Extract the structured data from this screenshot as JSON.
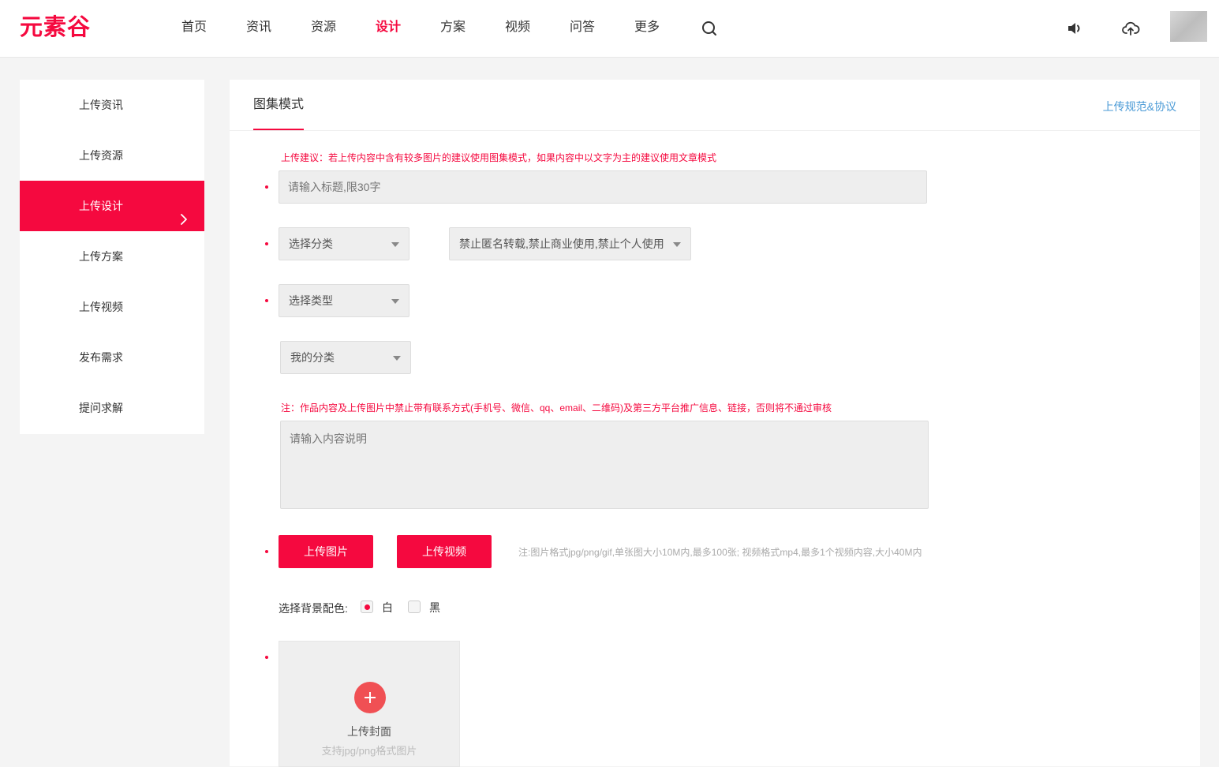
{
  "logo": {
    "text": "元素谷"
  },
  "nav": {
    "items": [
      "首页",
      "资讯",
      "资源",
      "设计",
      "方案",
      "视频",
      "问答",
      "更多"
    ],
    "active": "设计"
  },
  "header_icons": [
    "search-icon",
    "speaker-icon",
    "cloud-upload-icon",
    "avatar"
  ],
  "sidebar": {
    "items": [
      "上传资讯",
      "上传资源",
      "上传设计",
      "上传方案",
      "上传视频",
      "发布需求",
      "提问求解"
    ],
    "active": "上传设计"
  },
  "main": {
    "tab": "图集模式",
    "agreement_link": "上传规范&协议",
    "suggestion": "上传建议：若上传内容中含有较多图片的建议使用图集模式，如果内容中以文字为主的建议使用文章模式",
    "title_placeholder": "请输入标题,限30字",
    "category_select": "选择分类",
    "license_select": "禁止匿名转载,禁止商业使用,禁止个人使用",
    "type_select": "选择类型",
    "my_category_select": "我的分类",
    "content_notice": "注：作品内容及上传图片中禁止带有联系方式(手机号、微信、qq、email、二维码)及第三方平台推广信息、链接，否则将不通过审核",
    "content_placeholder": "请输入内容说明",
    "upload_image_button": "上传图片",
    "upload_video_button": "上传视频",
    "upload_hint": "注:图片格式jpg/png/gif,单张图大小10M内,最多100张; 视频格式mp4,最多1个视频内容,大小40M内",
    "bg_color_label": "选择背景配色:",
    "bg_options": [
      "白",
      "黑"
    ],
    "bg_selected": "白",
    "cover_title": "上传封面",
    "cover_subtitle": "支持jpg/png格式图片"
  },
  "colors": {
    "accent": "#f5093f",
    "link": "#4a9ad6",
    "page_bg": "#f4f4f4"
  }
}
